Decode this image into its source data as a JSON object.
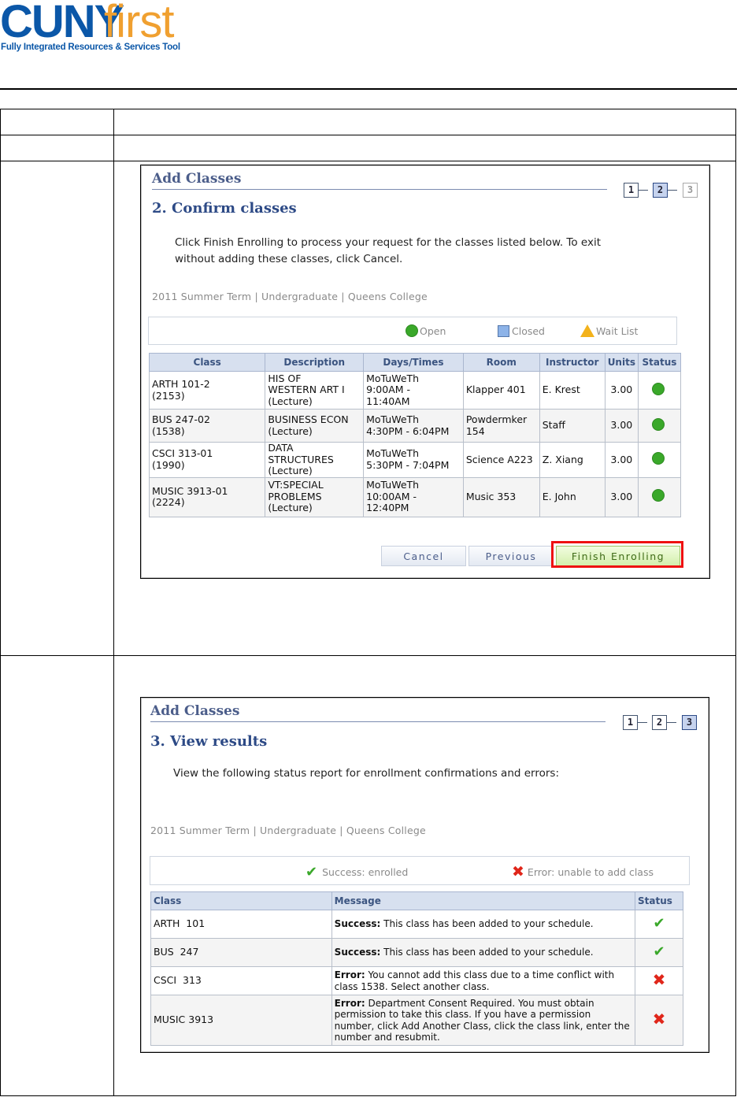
{
  "logo": {
    "cuny": "CUNY",
    "first": "first",
    "tagline": "Fully Integrated Resources & Services Tool"
  },
  "panel1": {
    "title": "Add Classes",
    "steps": [
      "1",
      "2",
      "3"
    ],
    "step_heading": "2.  Confirm classes",
    "instructions": "Click Finish Enrolling to process your request for the classes listed below. To exit without adding these classes, click Cancel.",
    "term": "2011 Summer Term | Undergraduate | Queens College",
    "legend": {
      "open": "Open",
      "closed": "Closed",
      "wait": "Wait List"
    },
    "columns": [
      "Class",
      "Description",
      "Days/Times",
      "Room",
      "Instructor",
      "Units",
      "Status"
    ],
    "rows": [
      {
        "class": "ARTH 101-2\n(2153)",
        "description": "HIS OF\nWESTERN ART I\n(Lecture)",
        "days": "MoTuWeTh\n9:00AM -\n11:40AM",
        "room": "Klapper 401",
        "instructor": "E. Krest",
        "units": "3.00"
      },
      {
        "class": "BUS 247-02\n(1538)",
        "description": "BUSINESS ECON\n(Lecture)",
        "days": "MoTuWeTh\n4:30PM - 6:04PM",
        "room": "Powdermker\n154",
        "instructor": "Staff",
        "units": "3.00"
      },
      {
        "class": "CSCI 313-01\n(1990)",
        "description": "DATA\nSTRUCTURES\n(Lecture)",
        "days": "MoTuWeTh\n5:30PM - 7:04PM",
        "room": "Science A223",
        "instructor": "Z. Xiang",
        "units": "3.00"
      },
      {
        "class": "MUSIC 3913-01\n(2224)",
        "description": "VT:SPECIAL\nPROBLEMS\n(Lecture)",
        "days": "MoTuWeTh\n10:00AM -\n12:40PM",
        "room": "Music 353",
        "instructor": "E. John",
        "units": "3.00"
      }
    ],
    "buttons": {
      "cancel": "Cancel",
      "previous": "Previous",
      "finish": "Finish Enrolling"
    }
  },
  "panel2": {
    "title": "Add Classes",
    "steps": [
      "1",
      "2",
      "3"
    ],
    "step_heading": "3.  View results",
    "instructions": "View the following status report for enrollment confirmations and errors:",
    "term": "2011 Summer Term | Undergraduate | Queens College",
    "legend": {
      "success": "Success: enrolled",
      "error": "Error: unable to add class"
    },
    "columns": [
      "Class",
      "Message",
      "Status"
    ],
    "rows": [
      {
        "class": "ARTH  101",
        "label": "Success:",
        "message": " This class has been added to your schedule.",
        "status": "success"
      },
      {
        "class": "BUS  247",
        "label": "Success:",
        "message": " This class has been added to your schedule.",
        "status": "success"
      },
      {
        "class": "CSCI  313",
        "label": "Error:",
        "message": " You cannot add this class due to a time conflict with class 1538. Select another class.",
        "status": "error"
      },
      {
        "class": "MUSIC 3913",
        "label": "Error:",
        "message": " Department Consent Required. You must obtain permission to take this class. If you have a permission number, click Add Another Class, click the class link, enter the number and resubmit.",
        "status": "error"
      }
    ]
  }
}
